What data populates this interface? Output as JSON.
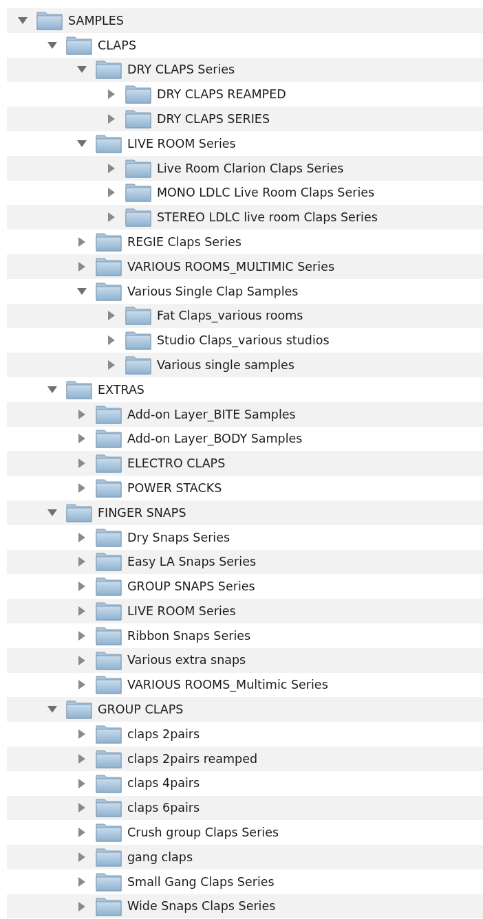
{
  "tree": [
    {
      "name": "SAMPLES",
      "expanded": true,
      "children": [
        {
          "name": "CLAPS",
          "expanded": true,
          "children": [
            {
              "name": "DRY CLAPS Series",
              "expanded": true,
              "children": [
                {
                  "name": "DRY CLAPS REAMPED",
                  "expanded": false
                },
                {
                  "name": "DRY CLAPS SERIES",
                  "expanded": false
                }
              ]
            },
            {
              "name": "LIVE ROOM Series",
              "expanded": true,
              "children": [
                {
                  "name": "Live Room Clarion Claps Series",
                  "expanded": false
                },
                {
                  "name": "MONO LDLC Live Room Claps Series",
                  "expanded": false
                },
                {
                  "name": "STEREO LDLC live room Claps Series",
                  "expanded": false
                }
              ]
            },
            {
              "name": "REGIE Claps Series",
              "expanded": false
            },
            {
              "name": "VARIOUS ROOMS_MULTIMIC Series",
              "expanded": false
            },
            {
              "name": "Various Single Clap Samples",
              "expanded": true,
              "children": [
                {
                  "name": "Fat Claps_various rooms",
                  "expanded": false
                },
                {
                  "name": "Studio Claps_various studios",
                  "expanded": false
                },
                {
                  "name": "Various single samples",
                  "expanded": false
                }
              ]
            }
          ]
        },
        {
          "name": "EXTRAS",
          "expanded": true,
          "children": [
            {
              "name": "Add-on Layer_BITE Samples",
              "expanded": false
            },
            {
              "name": "Add-on Layer_BODY Samples",
              "expanded": false
            },
            {
              "name": "ELECTRO CLAPS",
              "expanded": false
            },
            {
              "name": "POWER STACKS",
              "expanded": false
            }
          ]
        },
        {
          "name": "FINGER SNAPS",
          "expanded": true,
          "children": [
            {
              "name": "Dry Snaps Series",
              "expanded": false
            },
            {
              "name": "Easy LA Snaps Series",
              "expanded": false
            },
            {
              "name": "GROUP SNAPS Series",
              "expanded": false
            },
            {
              "name": "LIVE ROOM Series",
              "expanded": false
            },
            {
              "name": "Ribbon Snaps Series",
              "expanded": false
            },
            {
              "name": "Various extra snaps",
              "expanded": false
            },
            {
              "name": "VARIOUS ROOMS_Multimic Series",
              "expanded": false
            }
          ]
        },
        {
          "name": "GROUP CLAPS",
          "expanded": true,
          "children": [
            {
              "name": "claps 2pairs",
              "expanded": false
            },
            {
              "name": "claps 2pairs reamped",
              "expanded": false
            },
            {
              "name": "claps 4pairs",
              "expanded": false
            },
            {
              "name": "claps 6pairs",
              "expanded": false
            },
            {
              "name": "Crush group Claps Series",
              "expanded": false
            },
            {
              "name": "gang claps",
              "expanded": false
            },
            {
              "name": "Small Gang Claps Series",
              "expanded": false
            },
            {
              "name": "Wide Snaps Claps Series",
              "expanded": false
            }
          ]
        }
      ]
    }
  ]
}
